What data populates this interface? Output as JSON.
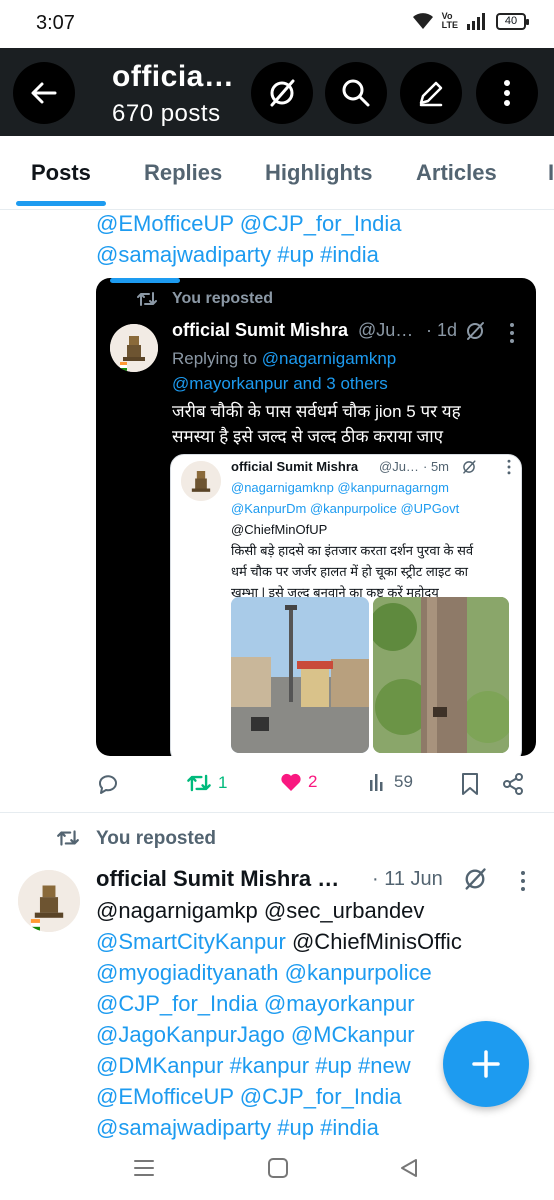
{
  "status_bar": {
    "time": "3:07",
    "battery": "40"
  },
  "header": {
    "name": "officia…",
    "posts_count": "670 posts"
  },
  "tabs": [
    "Posts",
    "Replies",
    "Highlights",
    "Articles"
  ],
  "top_post_tail": {
    "line1": "@EMofficeUP  @CJP_for_India",
    "line2": "@samajwadiparty #up #india"
  },
  "quote": {
    "reposted_label": "You reposted",
    "author": "official Sumit Mishra",
    "handle": "@Ju…",
    "time": "· 1d",
    "replying_prefix": "Replying to",
    "replying_to1": "@nagarnigamknp",
    "replying_to2": "@mayorkanpur and 3 others",
    "text_line1": "जरीब चौकी के पास सर्वधर्म चौक jion 5 पर यह",
    "text_line2": "समस्या है इसे जल्द से जल्द ठीक कराया जाए",
    "inner": {
      "author": "official Sumit Mishra",
      "handle": "@Ju…",
      "time": "· 5m",
      "line1": "@nagarnigamknp @kanpurnagarngm",
      "line2": "@KanpurDm @kanpurpolice @UPGovt",
      "line3": "@ChiefMinOfUP",
      "line4": "किसी बड़े हादसे का इंतजार करता दर्शन पुरवा के सर्व",
      "line5": "धर्म चौक पर जर्जर हालत में हो चूका स्ट्रीट लाइट का",
      "line6": "खम्भा | इसे जल्द बनवाने का कष्ट करें महोदय"
    }
  },
  "actions": {
    "reposts": "1",
    "likes": "2",
    "views": "59"
  },
  "post2": {
    "reposted_label": "You reposted",
    "author": "official Sumit Mishra …",
    "time": "· 11 Jun",
    "line1": "@nagarnigamkp @sec_urbandev",
    "line2_link": "@SmartCityKanpur",
    "line2_rest": "@ChiefMinisOffic",
    "line3a": "@myogiadityanath",
    "line3b": "@kanpurpolice",
    "line4a": "@CJP_for_India",
    "line4b": "@mayorkanpur",
    "line5a": "@JagoKanpurJago",
    "line5b": "@MCkanpur",
    "line6": "@DMKanpur  #kanpur #up #new",
    "line7": "@EMofficeUP  @CJP_for_India",
    "line8": "@samajwadiparty #up #india"
  },
  "colors": {
    "accent": "#1d9bf0",
    "repost_green": "#00ba7c",
    "like_pink": "#f91880",
    "header_bg": "#1b1f22"
  }
}
